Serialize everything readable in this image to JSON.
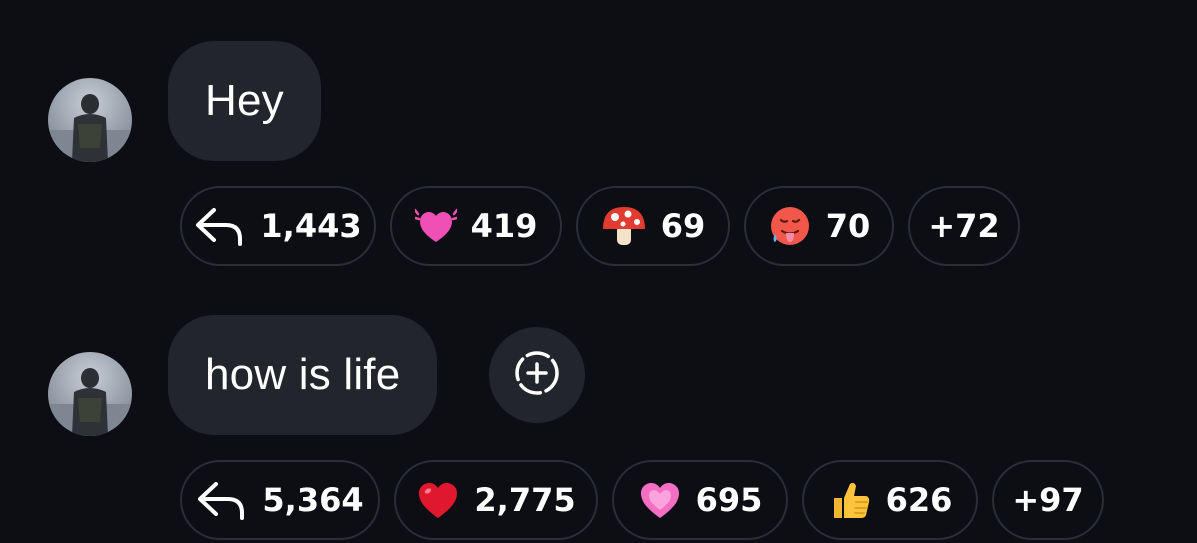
{
  "messages": [
    {
      "text": "Hey",
      "reactions": [
        {
          "icon": "reply-icon",
          "count": "1,443"
        },
        {
          "icon": "beating-heart-icon",
          "count": "419"
        },
        {
          "icon": "mushroom-icon",
          "count": "69"
        },
        {
          "icon": "hot-face-icon",
          "count": "70"
        },
        {
          "icon": "more-reactions",
          "count": "+72"
        }
      ]
    },
    {
      "text": "how is life",
      "add_reaction_icon": "add-reaction-icon",
      "reactions": [
        {
          "icon": "reply-icon",
          "count": "5,364"
        },
        {
          "icon": "red-heart-icon",
          "count": "2,775"
        },
        {
          "icon": "pink-heart-icon",
          "count": "695"
        },
        {
          "icon": "thumbs-up-icon",
          "count": "626"
        },
        {
          "icon": "more-reactions",
          "count": "+97"
        }
      ]
    }
  ],
  "colors": {
    "background": "#0c0e14",
    "bubble": "#22252c",
    "chip_border": "#2b2e36",
    "text": "#ffffff"
  }
}
